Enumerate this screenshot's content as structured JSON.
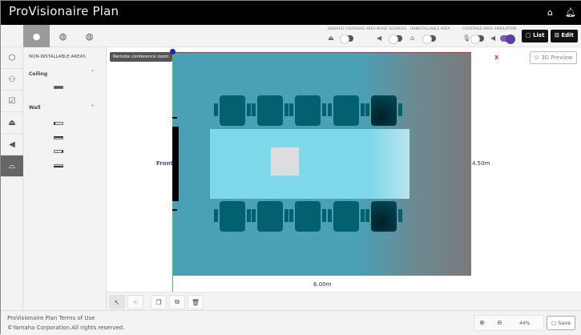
{
  "app": {
    "title": "ProVisionaire Plan",
    "home_icon": "home-icon",
    "bell_icon": "bell-icon"
  },
  "toolbar": {
    "views": [
      "top-view-icon",
      "perspective-view-icon",
      "3d-view-icon"
    ],
    "toggles": [
      {
        "label": "DESIRED COVERAGE AREA",
        "icon": "coverage-icon",
        "on": false
      },
      {
        "label": "NOISE SOURCES",
        "icon": "noise-icon",
        "on": false
      },
      {
        "label": "UNINSTALLABLE AREA",
        "icon": "uninstallable-icon",
        "on": false
      }
    ],
    "simulation": {
      "label": "COVERAGE AREA SIMULATION",
      "mic_on": false,
      "speaker_on": true
    },
    "list_label": "List",
    "edit_label": "Edit"
  },
  "rail": [
    "room-icon",
    "furniture-icon",
    "whiteboard-icon",
    "coverage-icon",
    "noise-icon",
    "uninstallable-icon"
  ],
  "panel": {
    "title": "NON-INSTALLABLE AREAS",
    "ceiling": "Ceiling",
    "wall": "Wall"
  },
  "canvas": {
    "room_name": "Remote conference room",
    "front": "Front",
    "width_label": "6.00m",
    "height_label": "4.50m",
    "x_axis": "X",
    "preview_label": "3D Preview"
  },
  "bottom_tools": [
    "select-icon",
    "pan-icon",
    "copy-icon",
    "duplicate-icon",
    "delete-icon"
  ],
  "footer": {
    "terms": "ProVisionaire Plan Terms of Use",
    "copyright": "©Yamaha Corporation.All rights reserved.",
    "zoom": "44%",
    "save": "Save"
  },
  "colors": {
    "room": "#4aa0b4",
    "table": "#7dd8ea",
    "chair": "#03606f",
    "accent": "#5b3fa0"
  }
}
